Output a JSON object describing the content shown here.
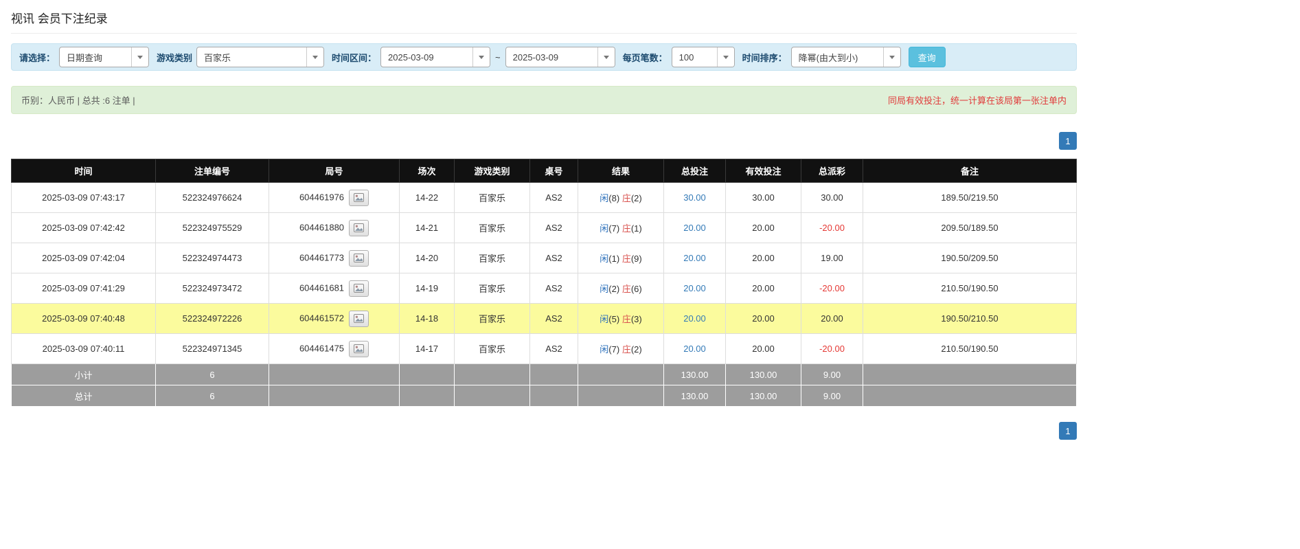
{
  "page": {
    "title": "视讯 会员下注纪录"
  },
  "filters": {
    "select_label": "请选择：",
    "select_value": "日期查询",
    "game_type_label": "游戏类别",
    "game_type_value": "百家乐",
    "time_range_label": "时间区间：",
    "date_from": "2025-03-09",
    "range_separator": "~",
    "date_to": "2025-03-09",
    "per_page_label": "每页笔数：",
    "per_page_value": "100",
    "sort_label": "时间排序：",
    "sort_value": "降幂(由大到小)",
    "search_button_label": "查询"
  },
  "summary": {
    "left_text": "币别：人民币 | 总共 :6 注单 |",
    "right_notice": "同局有效投注，统一计算在该局第一张注单内"
  },
  "pagination": {
    "current": "1"
  },
  "icons": {
    "dropdown_caret": "caret-down-icon",
    "round_result": "result-image-icon"
  },
  "colors": {
    "accent_blue": "#337ab7",
    "search_button": "#5bc0de",
    "filter_bar_bg": "#d9edf7",
    "summary_bar_bg": "#dff0d8",
    "highlight_row": "#fbfb9d",
    "negative_red": "#e53935",
    "notice_red": "#e03b3b",
    "header_bg": "#111111",
    "total_row_bg": "#9d9d9d"
  },
  "table": {
    "headers": [
      "时间",
      "注单编号",
      "局号",
      "场次",
      "游戏类别",
      "桌号",
      "结果",
      "总投注",
      "有效投注",
      "总派彩",
      "备注"
    ],
    "rows": [
      {
        "time": "2025-03-09 07:43:17",
        "bet_id": "522324976624",
        "round_id": "604461976",
        "session": "14-22",
        "game": "百家乐",
        "table_no": "AS2",
        "player": "闲",
        "player_score": "(8)",
        "banker": "庄",
        "banker_score": "(2)",
        "total_bet": "30.00",
        "valid_bet": "30.00",
        "payout": "30.00",
        "note": "189.50/219.50",
        "highlighted": false
      },
      {
        "time": "2025-03-09 07:42:42",
        "bet_id": "522324975529",
        "round_id": "604461880",
        "session": "14-21",
        "game": "百家乐",
        "table_no": "AS2",
        "player": "闲",
        "player_score": "(7)",
        "banker": "庄",
        "banker_score": "(1)",
        "total_bet": "20.00",
        "valid_bet": "20.00",
        "payout": "-20.00",
        "note": "209.50/189.50",
        "highlighted": false
      },
      {
        "time": "2025-03-09 07:42:04",
        "bet_id": "522324974473",
        "round_id": "604461773",
        "session": "14-20",
        "game": "百家乐",
        "table_no": "AS2",
        "player": "闲",
        "player_score": "(1)",
        "banker": "庄",
        "banker_score": "(9)",
        "total_bet": "20.00",
        "valid_bet": "20.00",
        "payout": "19.00",
        "note": "190.50/209.50",
        "highlighted": false
      },
      {
        "time": "2025-03-09 07:41:29",
        "bet_id": "522324973472",
        "round_id": "604461681",
        "session": "14-19",
        "game": "百家乐",
        "table_no": "AS2",
        "player": "闲",
        "player_score": "(2)",
        "banker": "庄",
        "banker_score": "(6)",
        "total_bet": "20.00",
        "valid_bet": "20.00",
        "payout": "-20.00",
        "note": "210.50/190.50",
        "highlighted": false
      },
      {
        "time": "2025-03-09 07:40:48",
        "bet_id": "522324972226",
        "round_id": "604461572",
        "session": "14-18",
        "game": "百家乐",
        "table_no": "AS2",
        "player": "闲",
        "player_score": "(5)",
        "banker": "庄",
        "banker_score": "(3)",
        "total_bet": "20.00",
        "valid_bet": "20.00",
        "payout": "20.00",
        "note": "190.50/210.50",
        "highlighted": true
      },
      {
        "time": "2025-03-09 07:40:11",
        "bet_id": "522324971345",
        "round_id": "604461475",
        "session": "14-17",
        "game": "百家乐",
        "table_no": "AS2",
        "player": "闲",
        "player_score": "(7)",
        "banker": "庄",
        "banker_score": "(2)",
        "total_bet": "20.00",
        "valid_bet": "20.00",
        "payout": "-20.00",
        "note": "210.50/190.50",
        "highlighted": false
      }
    ],
    "subtotal": {
      "label": "小计",
      "count": "6",
      "total_bet": "130.00",
      "valid_bet": "130.00",
      "payout": "9.00"
    },
    "total": {
      "label": "总计",
      "count": "6",
      "total_bet": "130.00",
      "valid_bet": "130.00",
      "payout": "9.00"
    }
  }
}
